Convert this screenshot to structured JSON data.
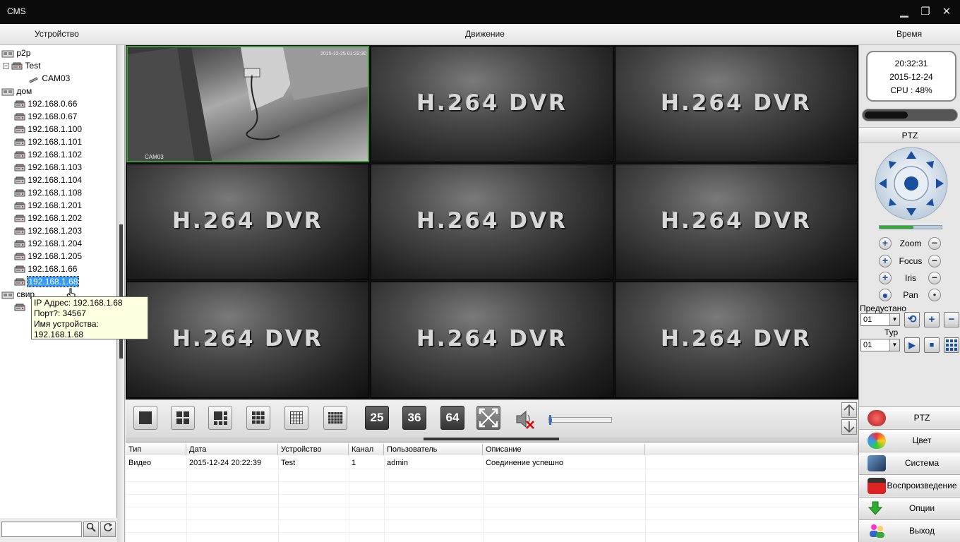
{
  "window": {
    "title": "CMS",
    "minimize": "▁",
    "maximize": "❐",
    "close": "✕"
  },
  "header": {
    "device": "Устройство",
    "motion": "Движение",
    "time": "Время"
  },
  "tree": {
    "groups": [
      {
        "label": "p2p"
      },
      {
        "label": "Test"
      },
      {
        "label": "CAM03"
      },
      {
        "label": "дом"
      }
    ],
    "devices": [
      "192.168.0.66",
      "192.168.0.67",
      "192.168.1.100",
      "192.168.1.101",
      "192.168.1.102",
      "192.168.1.103",
      "192.168.1.104",
      "192.168.1.108",
      "192.168.1.201",
      "192.168.1.202",
      "192.168.1.203",
      "192.168.1.204",
      "192.168.1.205",
      "192.168.1.66",
      "192.168.1.68"
    ],
    "selected": "192.168.1.68",
    "last_group": "свир"
  },
  "tooltip": {
    "line1": "IP Адрес: 192.168.1.68",
    "line2": "Порт?: 34567",
    "line3": "Имя устройства: 192.168.1.68"
  },
  "video": {
    "placeholder": "H.264 DVR",
    "cam_timestamp": "2015-12-25 01:22:30",
    "cam_label": "CAM03"
  },
  "toolbar": {
    "layout_25": "25",
    "layout_36": "36",
    "layout_64": "64",
    "volume": 0.05
  },
  "log": {
    "headers": [
      "Тип",
      "Дата",
      "Устройство",
      "Канал",
      "Пользователь",
      "Описание"
    ],
    "rows": [
      [
        "Видео",
        "2015-12-24 20:22:39",
        "Test",
        "1",
        "admin",
        "Соединение успешно"
      ]
    ]
  },
  "status": {
    "time": "20:32:31",
    "date": "2015-12-24",
    "cpu": "CPU : 48%",
    "cpu_value": 48
  },
  "ptz": {
    "title": "PTZ",
    "zoom": "Zoom",
    "focus": "Focus",
    "iris": "Iris",
    "pan": "Pan",
    "preset_label": "Предустано",
    "preset_value": "01",
    "tour_label": "Тур",
    "tour_value": "01",
    "speed": 0.55
  },
  "menu": {
    "ptz": "PTZ",
    "color": "Цвет",
    "system": "Система",
    "playback": "Воспроизведение",
    "options": "Опции",
    "exit": "Выход"
  },
  "colors": {
    "titlebar": "#0b0b0b",
    "selection": "#3399ff",
    "ptz_blue": "#1a4fa0",
    "active_cell": "#3a9a3a"
  }
}
